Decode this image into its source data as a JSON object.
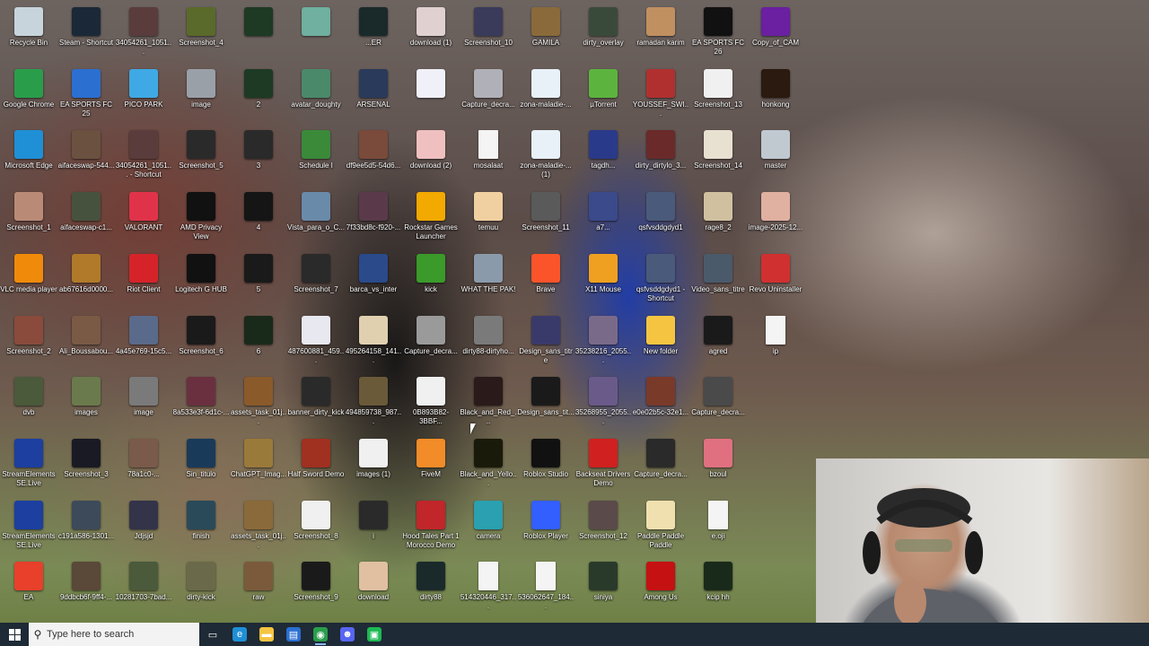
{
  "colors": {
    "taskbar": "#1e2a35",
    "search_bg": "#f3f3f3"
  },
  "desktop_icons": [
    {
      "label": "Recycle Bin",
      "icon": "recycle-bin-icon",
      "color": "#c8d4dc"
    },
    {
      "label": "Google Chrome",
      "icon": "chrome-icon",
      "color": "#2a9d4b"
    },
    {
      "label": "Microsoft Edge",
      "icon": "edge-icon",
      "color": "#1f8fd6"
    },
    {
      "label": "Screenshot_1",
      "icon": "image-file-icon",
      "color": "#b98b77"
    },
    {
      "label": "VLC media player",
      "icon": "vlc-icon",
      "color": "#f08a0a"
    },
    {
      "label": "Screenshot_2",
      "icon": "image-file-icon",
      "color": "#8a4b3c"
    },
    {
      "label": "dvb",
      "icon": "image-file-icon",
      "color": "#4a5a3a"
    },
    {
      "label": "StreamElements SE.Live",
      "icon": "streamelements-icon",
      "color": "#1c3fa0"
    },
    {
      "label": "StreamElements SE.Live",
      "icon": "streamelements-icon",
      "color": "#1c3fa0"
    },
    {
      "label": "EA",
      "icon": "ea-icon",
      "color": "#e8402a"
    },
    {
      "label": "Steam - Shortcut",
      "icon": "steam-icon",
      "color": "#1b2838"
    },
    {
      "label": "EA SPORTS FC 25",
      "icon": "ea-sports-icon",
      "color": "#2b6fd1"
    },
    {
      "label": "aifaceswap-544...",
      "icon": "image-file-icon",
      "color": "#6b5140"
    },
    {
      "label": "aifaceswap-c1...",
      "icon": "image-file-icon",
      "color": "#47523e"
    },
    {
      "label": "ab67616d0000...",
      "icon": "image-file-icon",
      "color": "#b07a2a"
    },
    {
      "label": "Ali_Boussabou...",
      "icon": "image-file-icon",
      "color": "#7a5a45"
    },
    {
      "label": "images",
      "icon": "image-file-icon",
      "color": "#6a7a4c"
    },
    {
      "label": "Screenshot_3",
      "icon": "image-file-icon",
      "color": "#1a1a24"
    },
    {
      "label": "c191a586-1301...",
      "icon": "image-file-icon",
      "color": "#3d4a5a"
    },
    {
      "label": "9ddbcb6f-9ff4-...",
      "icon": "image-file-icon",
      "color": "#5a4838"
    },
    {
      "label": "34054261_1051...",
      "icon": "image-file-icon",
      "color": "#5a3c3c"
    },
    {
      "label": "PICO PARK",
      "icon": "pico-park-icon",
      "color": "#3fa9e5"
    },
    {
      "label": "34054261_1051... - Shortcut",
      "icon": "image-file-icon",
      "color": "#5a3c3c"
    },
    {
      "label": "VALORANT",
      "icon": "valorant-icon",
      "color": "#e0334a"
    },
    {
      "label": "Riot Client",
      "icon": "riot-icon",
      "color": "#d6232a"
    },
    {
      "label": "4a45e769-15c5...",
      "icon": "image-file-icon",
      "color": "#5a6a8a"
    },
    {
      "label": "image",
      "icon": "image-file-icon",
      "color": "#7a7a7a"
    },
    {
      "label": "78a1c0-...",
      "icon": "image-file-icon",
      "color": "#7a5a4a"
    },
    {
      "label": "Jdjsjd",
      "icon": "image-file-icon",
      "color": "#33334a"
    },
    {
      "label": "10281703-7bad...",
      "icon": "image-file-icon",
      "color": "#4a5a3a"
    },
    {
      "label": "Screenshot_4",
      "icon": "image-file-icon",
      "color": "#5a6a2a"
    },
    {
      "label": "image",
      "icon": "image-file-icon",
      "color": "#9aa0a8"
    },
    {
      "label": "Screenshot_5",
      "icon": "image-file-icon",
      "color": "#2a2a2a"
    },
    {
      "label": "AMD Privacy View",
      "icon": "amd-icon",
      "color": "#111111"
    },
    {
      "label": "Logitech G HUB",
      "icon": "logitech-icon",
      "color": "#111111"
    },
    {
      "label": "Screenshot_6",
      "icon": "image-file-icon",
      "color": "#1a1a1a"
    },
    {
      "label": "8a533e3f-6d1c-...",
      "icon": "image-file-icon",
      "color": "#6a3040"
    },
    {
      "label": "Sin_titulo",
      "icon": "image-file-icon",
      "color": "#1a3a5a"
    },
    {
      "label": "finish",
      "icon": "image-file-icon",
      "color": "#2a4a5a"
    },
    {
      "label": "dirty-kick",
      "icon": "image-file-icon",
      "color": "#6a6a4a"
    },
    {
      "label": "",
      "icon": "image-file-icon",
      "color": "#1e3a24"
    },
    {
      "label": "2",
      "icon": "image-file-icon",
      "color": "#1e3a24"
    },
    {
      "label": "3",
      "icon": "image-file-icon",
      "color": "#2a2a2a"
    },
    {
      "label": "4",
      "icon": "image-file-icon",
      "color": "#151515"
    },
    {
      "label": "5",
      "icon": "image-file-icon",
      "color": "#1a1a1a"
    },
    {
      "label": "6",
      "icon": "image-file-icon",
      "color": "#1a2a1a"
    },
    {
      "label": "assets_task_01j...",
      "icon": "image-file-icon",
      "color": "#8a5a2a"
    },
    {
      "label": "ChatGPT_Imag...",
      "icon": "image-file-icon",
      "color": "#9a7a3a"
    },
    {
      "label": "assets_task_01j...",
      "icon": "image-file-icon",
      "color": "#8a6a3a"
    },
    {
      "label": "raw",
      "icon": "image-file-icon",
      "color": "#7a5a3a"
    },
    {
      "label": "",
      "icon": "image-file-icon",
      "color": "#6fb0a0"
    },
    {
      "label": "avatar_doughty",
      "icon": "image-file-icon",
      "color": "#4a8a6a"
    },
    {
      "label": "Schedule I",
      "icon": "schedule-icon",
      "color": "#3a8a3a"
    },
    {
      "label": "Vista_para_o_C...",
      "icon": "image-file-icon",
      "color": "#6a8aaa"
    },
    {
      "label": "Screenshot_7",
      "icon": "image-file-icon",
      "color": "#2a2a2a"
    },
    {
      "label": "487600881_459...",
      "icon": "image-file-icon",
      "color": "#e8e8f0"
    },
    {
      "label": "banner_dirty_kick",
      "icon": "image-file-icon",
      "color": "#2a2a2a"
    },
    {
      "label": "Half Sword Demo",
      "icon": "half-sword-icon",
      "color": "#a03020"
    },
    {
      "label": "Screenshot_8",
      "icon": "image-file-icon",
      "color": "#f0f0f0"
    },
    {
      "label": "Screenshot_9",
      "icon": "image-file-icon",
      "color": "#1a1a1a"
    },
    {
      "label": "...ER",
      "icon": "image-file-icon",
      "color": "#1a2a2a"
    },
    {
      "label": "ARSENAL",
      "icon": "image-file-icon",
      "color": "#2a3a5a"
    },
    {
      "label": "df9ee5d5-54d6...",
      "icon": "image-file-icon",
      "color": "#7a4a3a"
    },
    {
      "label": "7f33bd8c-f920-...",
      "icon": "image-file-icon",
      "color": "#5a3a4a"
    },
    {
      "label": "barca_vs_inter",
      "icon": "image-file-icon",
      "color": "#2a4a8a"
    },
    {
      "label": "495264158_141...",
      "icon": "image-file-icon",
      "color": "#e0d0b0"
    },
    {
      "label": "494859738_987...",
      "icon": "image-file-icon",
      "color": "#6a5a3a"
    },
    {
      "label": "images (1)",
      "icon": "image-file-icon",
      "color": "#f0f0f0"
    },
    {
      "label": "i",
      "icon": "image-file-icon",
      "color": "#2a2a2a"
    },
    {
      "label": "download",
      "icon": "image-file-icon",
      "color": "#e0c0a0"
    },
    {
      "label": "download (1)",
      "icon": "image-file-icon",
      "color": "#e0d0d0"
    },
    {
      "label": "",
      "icon": "image-file-icon",
      "color": "#f0f0f8"
    },
    {
      "label": "download (2)",
      "icon": "image-file-icon",
      "color": "#f0c0c0"
    },
    {
      "label": "Rockstar Games Launcher",
      "icon": "rockstar-icon",
      "color": "#f2a900"
    },
    {
      "label": "kick",
      "icon": "image-file-icon",
      "color": "#3a9a2a"
    },
    {
      "label": "Capture_decra...",
      "icon": "image-file-icon",
      "color": "#9a9a9a"
    },
    {
      "label": "0B893B82-3BBF...",
      "icon": "image-file-icon",
      "color": "#f0f0f0"
    },
    {
      "label": "FiveM",
      "icon": "fivem-icon",
      "color": "#f28c28"
    },
    {
      "label": "Hood Tales Part 1 Morocco Demo",
      "icon": "hood-tales-icon",
      "color": "#c0262a"
    },
    {
      "label": "dirty88",
      "icon": "image-file-icon",
      "color": "#1a2a2a"
    },
    {
      "label": "Screenshot_10",
      "icon": "image-file-icon",
      "color": "#3a3a5a"
    },
    {
      "label": "Capture_decra...",
      "icon": "image-file-icon",
      "color": "#b0b0b8"
    },
    {
      "label": "mosalaat",
      "icon": "blank-file-icon",
      "color": "#f4f4f4"
    },
    {
      "label": "temuu",
      "icon": "image-file-icon",
      "color": "#f0d0a0"
    },
    {
      "label": "WHAT THE PAK!",
      "icon": "image-file-icon",
      "color": "#8a9aaa"
    },
    {
      "label": "dirty88-dirtyho...",
      "icon": "image-file-icon",
      "color": "#7a7a7a"
    },
    {
      "label": "Black_and_Red_...",
      "icon": "image-file-icon",
      "color": "#2a1a1a"
    },
    {
      "label": "Black_and_Yello...",
      "icon": "image-file-icon",
      "color": "#1a1a0a"
    },
    {
      "label": "camera",
      "icon": "image-file-icon",
      "color": "#2aa0b0"
    },
    {
      "label": "514320446_317...",
      "icon": "blank-file-icon",
      "color": "#f4f4f4"
    },
    {
      "label": "GAMILA",
      "icon": "image-file-icon",
      "color": "#8a6a3a"
    },
    {
      "label": "zona-maladie-...",
      "icon": "image-file-icon",
      "color": "#e8f0f8"
    },
    {
      "label": "zona-maladie-... (1)",
      "icon": "image-file-icon",
      "color": "#e8f0f8"
    },
    {
      "label": "Screenshot_11",
      "icon": "image-file-icon",
      "color": "#5a5a5a"
    },
    {
      "label": "Brave",
      "icon": "brave-icon",
      "color": "#fb542b"
    },
    {
      "label": "Design_sans_titre",
      "icon": "image-file-icon",
      "color": "#3a3a6a"
    },
    {
      "label": "Design_sans_tit...",
      "icon": "image-file-icon",
      "color": "#1a1a1a"
    },
    {
      "label": "Roblox Studio",
      "icon": "roblox-studio-icon",
      "color": "#111111"
    },
    {
      "label": "Roblox Player",
      "icon": "roblox-icon",
      "color": "#335fff"
    },
    {
      "label": "536062647_184...",
      "icon": "blank-file-icon",
      "color": "#f4f4f4"
    },
    {
      "label": "dirty_overlay",
      "icon": "image-file-icon",
      "color": "#3a4a3a"
    },
    {
      "label": "µTorrent",
      "icon": "utorrent-icon",
      "color": "#5cb43e"
    },
    {
      "label": "tagdh...",
      "icon": "image-file-icon",
      "color": "#2a3a8a"
    },
    {
      "label": "a7...",
      "icon": "image-file-icon",
      "color": "#3a4a8a"
    },
    {
      "label": "X11 Mouse",
      "icon": "x11-mouse-icon",
      "color": "#f0a020"
    },
    {
      "label": "35238216_2055...",
      "icon": "image-file-icon",
      "color": "#7a6a8a"
    },
    {
      "label": "35268955_2055...",
      "icon": "image-file-icon",
      "color": "#6a5a8a"
    },
    {
      "label": "Backseat Drivers Demo",
      "icon": "backseat-drivers-icon",
      "color": "#d02020"
    },
    {
      "label": "Screenshot_12",
      "icon": "image-file-icon",
      "color": "#5a4a4a"
    },
    {
      "label": "siniya",
      "icon": "image-file-icon",
      "color": "#2a3a2a"
    },
    {
      "label": "ramadan karim",
      "icon": "image-file-icon",
      "color": "#c09060"
    },
    {
      "label": "YOUSSEF_SWI...",
      "icon": "image-file-icon",
      "color": "#b03030"
    },
    {
      "label": "dirty_dirtylo_3...",
      "icon": "image-file-icon",
      "color": "#6a2a2a"
    },
    {
      "label": "qsfvsddgdyd1",
      "icon": "image-file-icon",
      "color": "#4a5a7a"
    },
    {
      "label": "qsfvsddgdyd1 - Shortcut",
      "icon": "image-file-icon",
      "color": "#4a5a7a"
    },
    {
      "label": "New folder",
      "icon": "folder-icon",
      "color": "#f5c542"
    },
    {
      "label": "e0e02b5c-32e1...",
      "icon": "image-file-icon",
      "color": "#7a3a2a"
    },
    {
      "label": "Capture_decra...",
      "icon": "image-file-icon",
      "color": "#2a2a2a"
    },
    {
      "label": "Paddle Paddle Paddle",
      "icon": "paddle-icon",
      "color": "#f0e0b0"
    },
    {
      "label": "Among Us",
      "icon": "among-us-icon",
      "color": "#c51111"
    },
    {
      "label": "EA SPORTS FC 26",
      "icon": "ea-sports-icon",
      "color": "#111111"
    },
    {
      "label": "Screenshot_13",
      "icon": "image-file-icon",
      "color": "#f0f0f0"
    },
    {
      "label": "Screenshot_14",
      "icon": "image-file-icon",
      "color": "#e8e0d0"
    },
    {
      "label": "rage8_2",
      "icon": "image-file-icon",
      "color": "#d0c0a0"
    },
    {
      "label": "Video_sans_titre",
      "icon": "image-file-icon",
      "color": "#4a5a6a"
    },
    {
      "label": "agred",
      "icon": "image-file-icon",
      "color": "#1a1a1a"
    },
    {
      "label": "Capture_decra...",
      "icon": "image-file-icon",
      "color": "#4a4a4a"
    },
    {
      "label": "bzoul",
      "icon": "image-file-icon",
      "color": "#e07080"
    },
    {
      "label": "e.oji",
      "icon": "blank-file-icon",
      "color": "#f4f4f4"
    },
    {
      "label": "kcip hh",
      "icon": "image-file-icon",
      "color": "#1a2a1a"
    },
    {
      "label": "Copy_of_CAM",
      "icon": "image-file-icon",
      "color": "#6a20a0"
    },
    {
      "label": "honkong",
      "icon": "image-file-icon",
      "color": "#2a1a10"
    },
    {
      "label": "master",
      "icon": "image-file-icon",
      "color": "#c0c8d0"
    },
    {
      "label": "image-2025-12...",
      "icon": "image-file-icon",
      "color": "#e0b0a0"
    },
    {
      "label": "Revo Uninstaller",
      "icon": "revo-icon",
      "color": "#d03030"
    },
    {
      "label": "ip",
      "icon": "blank-file-icon",
      "color": "#f4f4f4"
    }
  ],
  "taskbar": {
    "search_placeholder": "Type here to search",
    "apps": [
      {
        "name": "task-view",
        "color": "#1e2a35",
        "glyph": "▭"
      },
      {
        "name": "edge",
        "color": "#1f8fd6",
        "glyph": "e"
      },
      {
        "name": "file-explorer",
        "color": "#f5c542",
        "glyph": "▬"
      },
      {
        "name": "store",
        "color": "#2a6fd1",
        "glyph": "▤"
      },
      {
        "name": "chrome",
        "color": "#2a9d4b",
        "glyph": "◉",
        "active": true
      },
      {
        "name": "discord",
        "color": "#5865f2",
        "glyph": "☻"
      },
      {
        "name": "app-green",
        "color": "#1db954",
        "glyph": "▣"
      }
    ]
  }
}
